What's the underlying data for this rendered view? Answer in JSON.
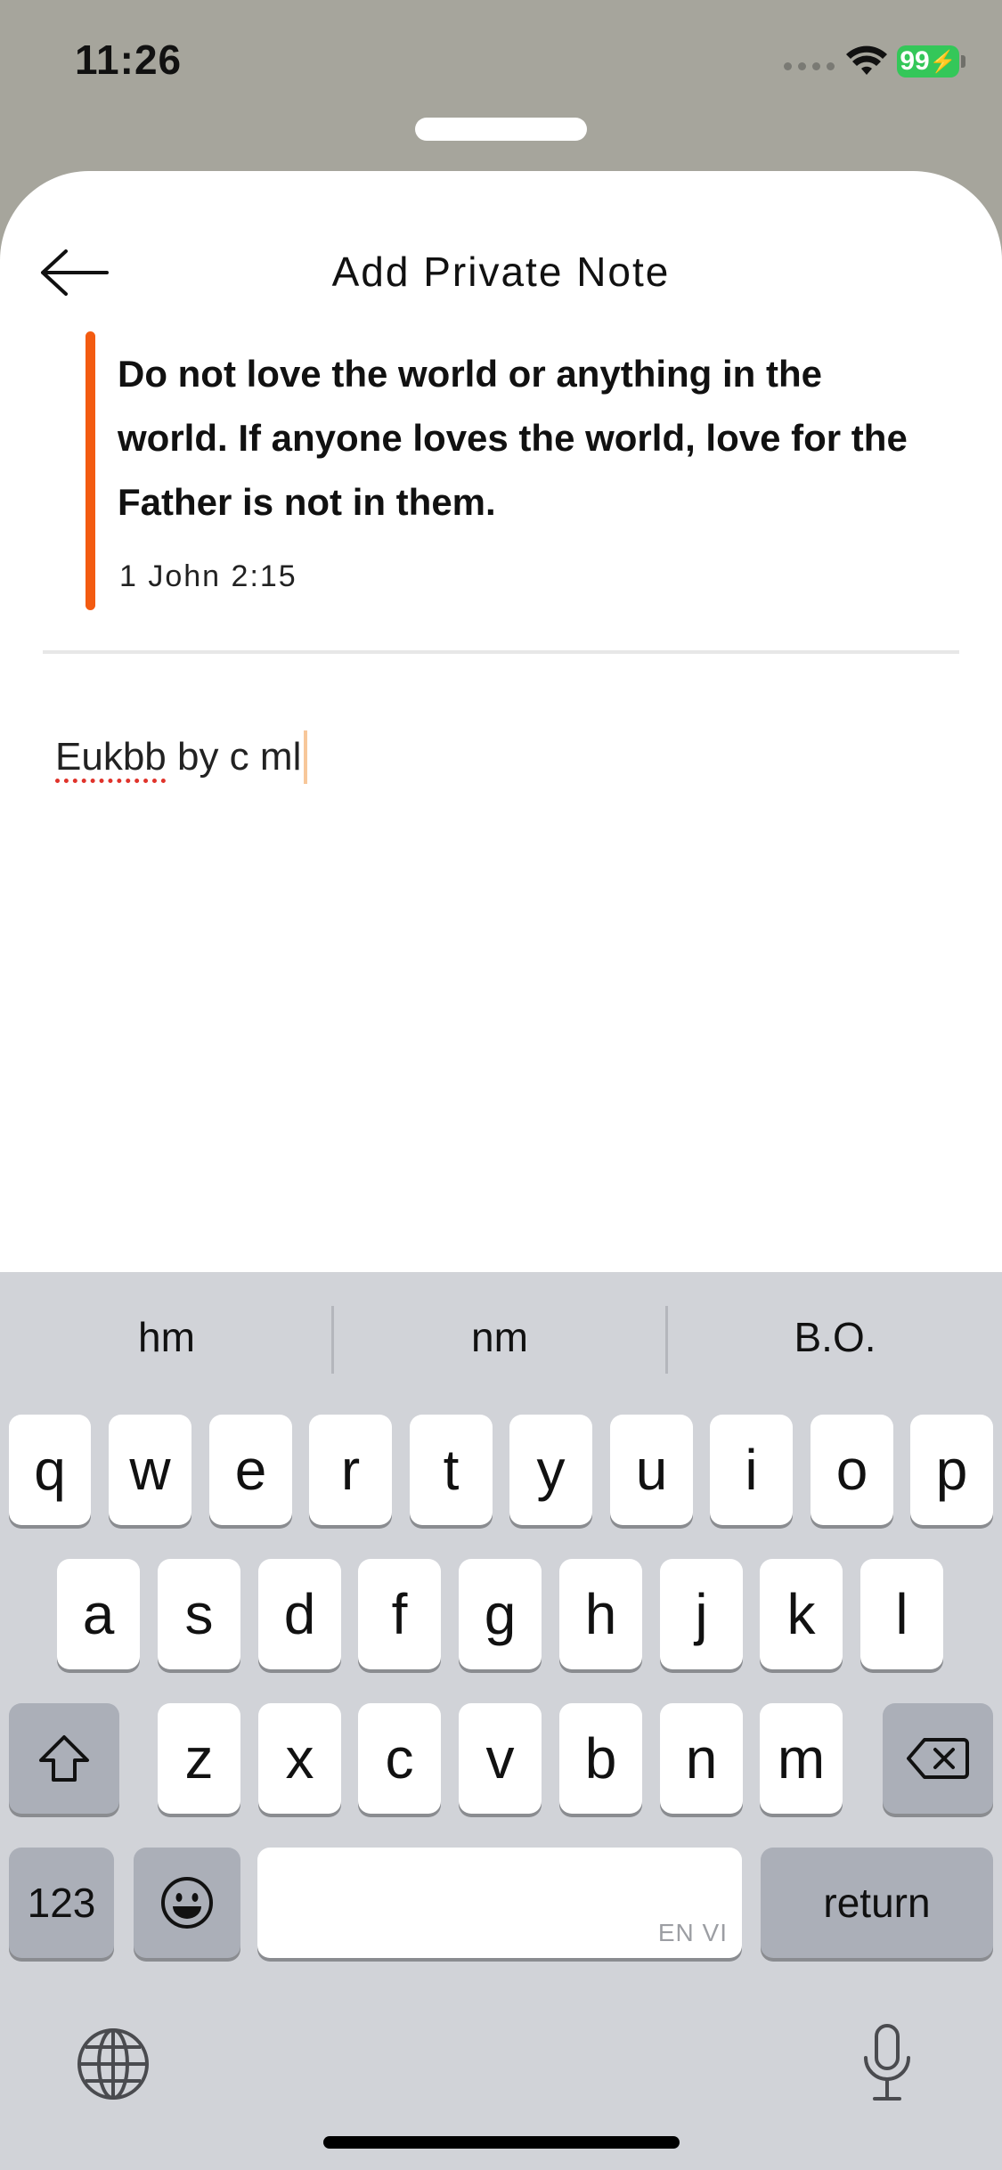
{
  "status": {
    "time": "11:26",
    "battery": "99"
  },
  "header": {
    "title": "Add Private Note"
  },
  "verse": {
    "text": "Do not love the world or anything in the world. If anyone loves the world, love for the Father is not in them.",
    "reference": "1 John 2:15",
    "accent_color": "#f35b11"
  },
  "note": {
    "misspelled_word": "Eukbb",
    "rest": " by c ml"
  },
  "keyboard": {
    "suggestions": [
      "hm",
      "nm",
      "B.O."
    ],
    "row1": [
      "q",
      "w",
      "e",
      "r",
      "t",
      "y",
      "u",
      "i",
      "o",
      "p"
    ],
    "row2": [
      "a",
      "s",
      "d",
      "f",
      "g",
      "h",
      "j",
      "k",
      "l"
    ],
    "row3": [
      "z",
      "x",
      "c",
      "v",
      "b",
      "n",
      "m"
    ],
    "numbers_label": "123",
    "space_language": "EN VI",
    "return_label": "return",
    "icons": [
      "shift-icon",
      "delete-icon",
      "emoji-icon",
      "globe-icon",
      "microphone-icon"
    ]
  }
}
